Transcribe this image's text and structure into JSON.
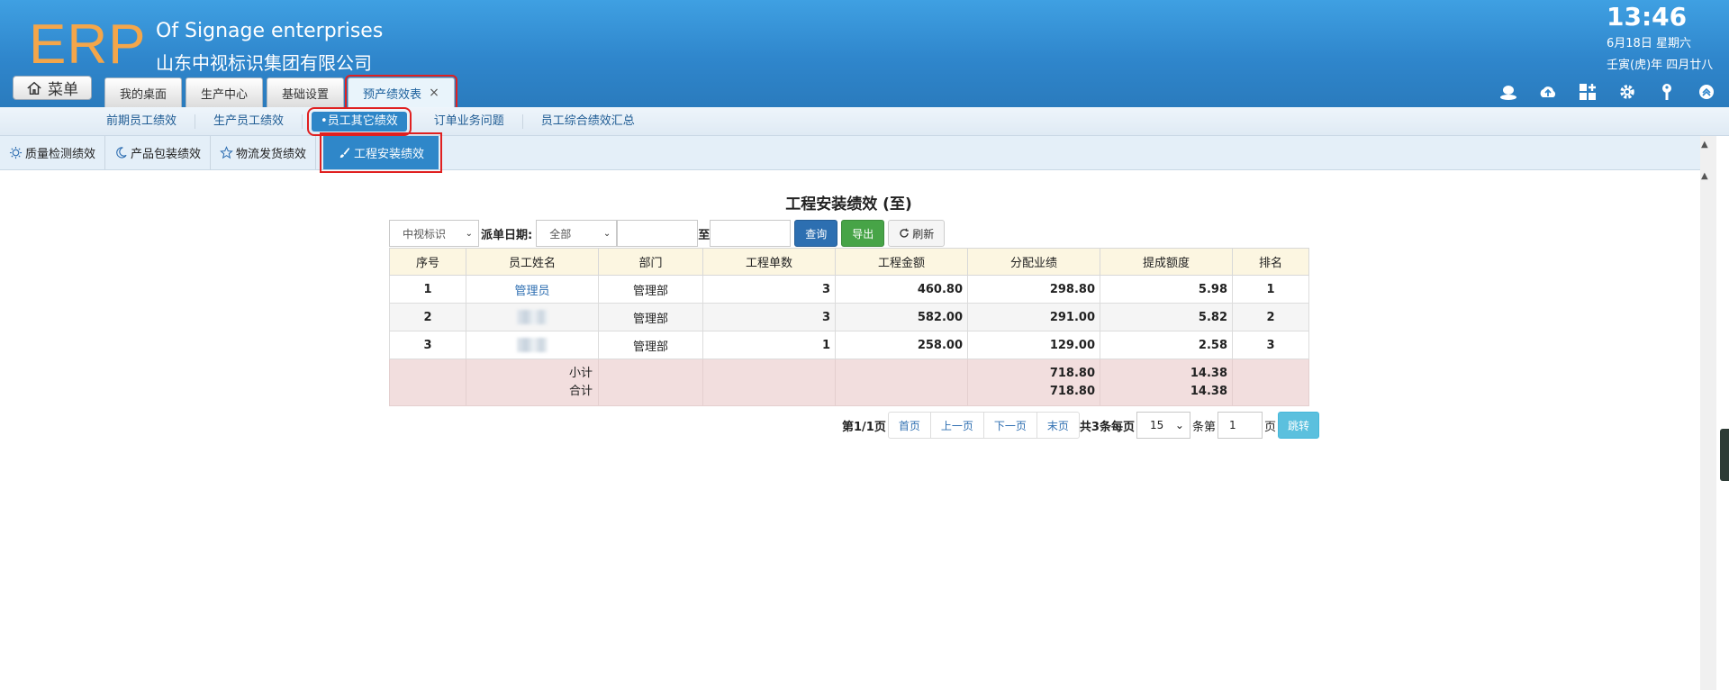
{
  "header": {
    "logo": "ERP",
    "company_en": "Of Signage enterprises",
    "company_cn": "山东中视标识集团有限公司",
    "time": "13:46",
    "date": "6月18日 星期六",
    "lunar": "壬寅(虎)年 四月廿八",
    "menu_label": "菜单",
    "tabs": [
      {
        "label": "我的桌面"
      },
      {
        "label": "生产中心"
      },
      {
        "label": "基础设置"
      },
      {
        "label": "预产绩效表",
        "active": true,
        "close": "×"
      }
    ],
    "icons": [
      "user-icon",
      "cloud-upload-icon",
      "grid-add-icon",
      "gear-icon",
      "key-icon",
      "chevron-up-circle-icon"
    ]
  },
  "subnav": {
    "items": [
      {
        "label": "前期员工绩效"
      },
      {
        "label": "生产员工绩效"
      },
      {
        "label": "•员工其它绩效",
        "active": true
      },
      {
        "label": "订单业务问题"
      },
      {
        "label": "员工综合绩效汇总"
      }
    ]
  },
  "third_tabs": [
    {
      "label": "质量检测绩效",
      "icon": "sun-icon"
    },
    {
      "label": "产品包装绩效",
      "icon": "moon-icon"
    },
    {
      "label": "物流发货绩效",
      "icon": "star-icon"
    },
    {
      "label": "工程安装绩效",
      "icon": "brush-icon",
      "active": true
    }
  ],
  "main": {
    "title": "工程安装绩效 (至)",
    "filters": {
      "company_select": "中视标识",
      "date_label": "派单日期:",
      "range_select": "全部",
      "start_date": "",
      "to_label": "至",
      "end_date": "",
      "query": "查询",
      "export": "导出",
      "refresh": "刷新"
    },
    "table": {
      "headers": [
        "序号",
        "员工姓名",
        "部门",
        "工程单数",
        "工程金额",
        "分配业绩",
        "提成额度",
        "排名"
      ],
      "rows": [
        {
          "no": "1",
          "name": "管理员",
          "dept": "管理部",
          "count": "3",
          "amount": "460.80",
          "perf": "298.80",
          "commission": "5.98",
          "rank": "1"
        },
        {
          "no": "2",
          "name": "",
          "dept": "管理部",
          "count": "3",
          "amount": "582.00",
          "perf": "291.00",
          "commission": "5.82",
          "rank": "2"
        },
        {
          "no": "3",
          "name": "",
          "dept": "管理部",
          "count": "1",
          "amount": "258.00",
          "perf": "129.00",
          "commission": "2.58",
          "rank": "3"
        }
      ],
      "subtotal_label": "小计",
      "total_label": "合计",
      "subtotal_perf": "718.80",
      "subtotal_commission": "14.38",
      "total_perf": "718.80",
      "total_commission": "14.38"
    },
    "pager": {
      "page_info": "第1/1页",
      "first": "首页",
      "prev": "上一页",
      "next": "下一页",
      "last": "末页",
      "total_info": "共3条每页",
      "page_size": "15",
      "goto_prefix": "条第",
      "goto_value": "1",
      "goto_suffix": "页",
      "jump": "跳转"
    }
  }
}
